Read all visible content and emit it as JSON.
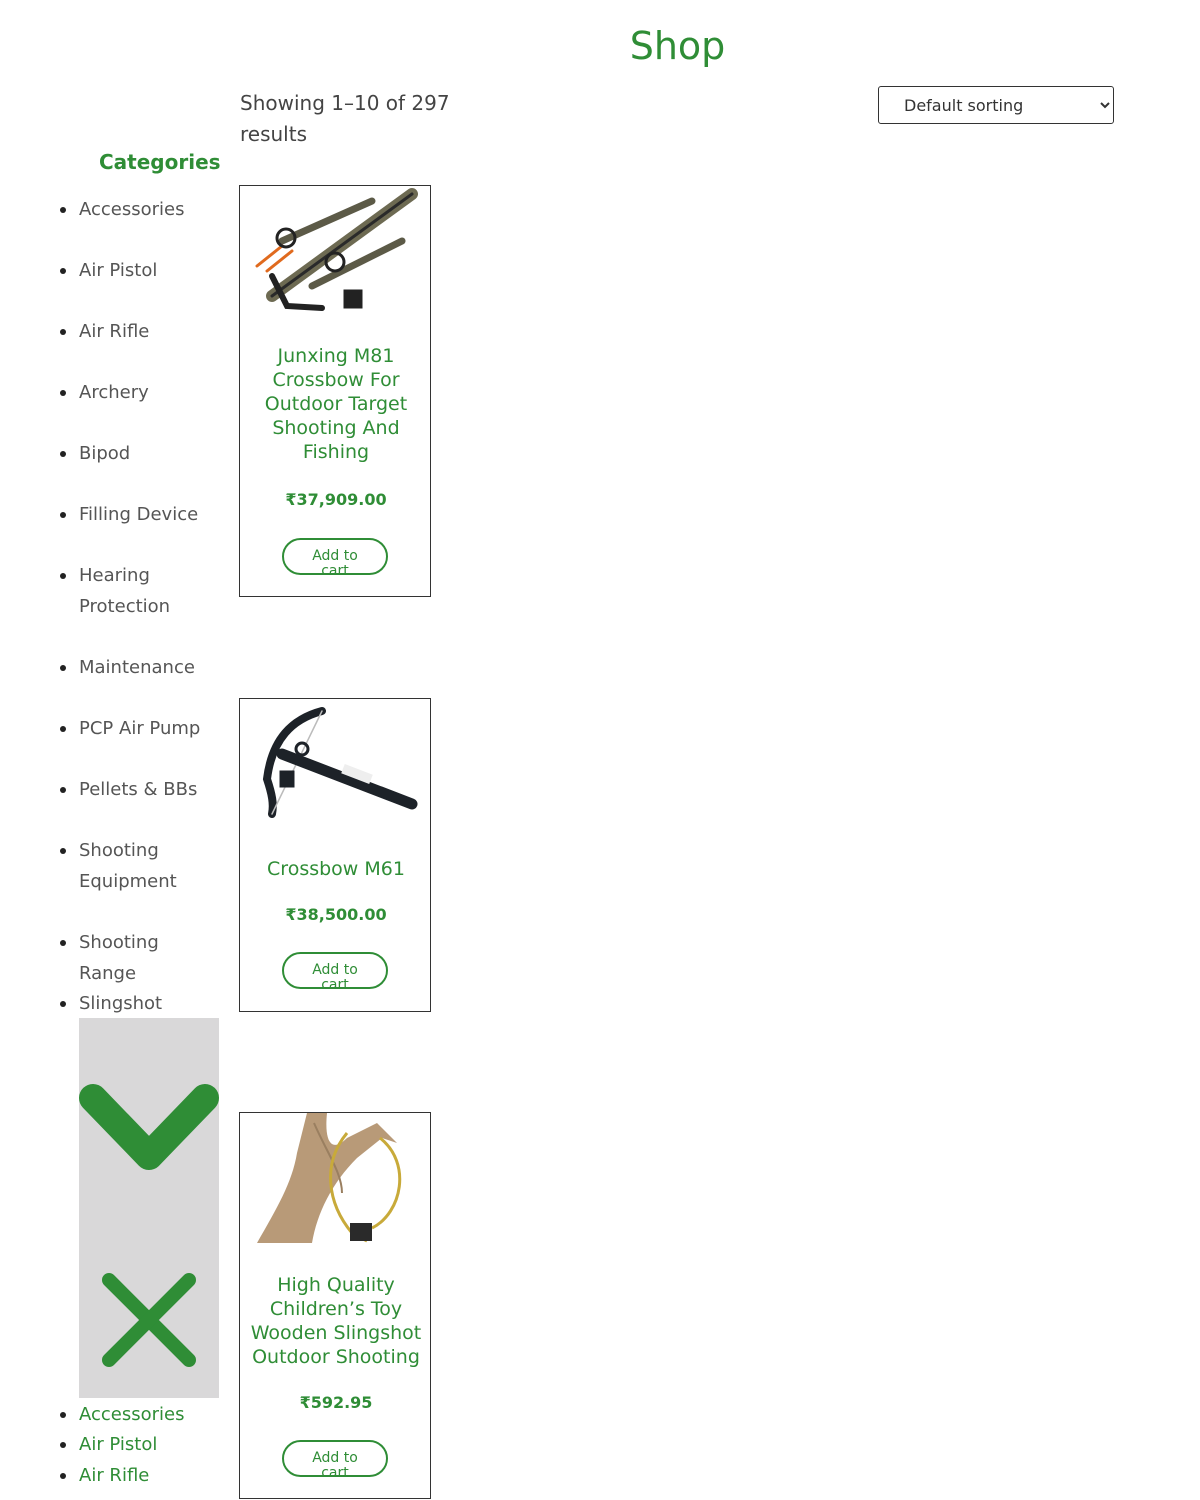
{
  "page": {
    "title": "Shop"
  },
  "results": {
    "count_text": "Showing 1–10 of 297 results"
  },
  "sorting": {
    "selected": "Default sorting"
  },
  "sidebar": {
    "title": "Categories",
    "categories": [
      "Accessories",
      "Air Pistol",
      "Air Rifle",
      "Archery",
      "Bipod",
      "Filling Device",
      "Hearing Protection",
      "Maintenance",
      "PCP Air Pump",
      "Pellets & BBs",
      "Shooting Equipment",
      "Shooting Range",
      "Slingshot"
    ],
    "toggle": {
      "open_icon": "chevron-down-icon",
      "close_icon": "close-icon"
    },
    "mobile_categories": [
      "Accessories",
      "Air Pistol",
      "Air Rifle"
    ]
  },
  "products": [
    {
      "name": "Junxing M81 Crossbow For Outdoor Target Shooting And Fishing",
      "price": "₹37,909.00",
      "button": "Add to cart",
      "image": "crossbow-camo-image"
    },
    {
      "name": "Crossbow M61",
      "price": "₹38,500.00",
      "button": "Add to cart",
      "image": "crossbow-black-image"
    },
    {
      "name": "High Quality Children’s Toy Wooden Slingshot Outdoor Shooting",
      "price": "₹592.95",
      "button": "Add to cart",
      "image": "wooden-slingshot-image"
    }
  ],
  "colors": {
    "accent": "#2f8d36",
    "panel": "#d9d8d9",
    "text": "#444444"
  }
}
